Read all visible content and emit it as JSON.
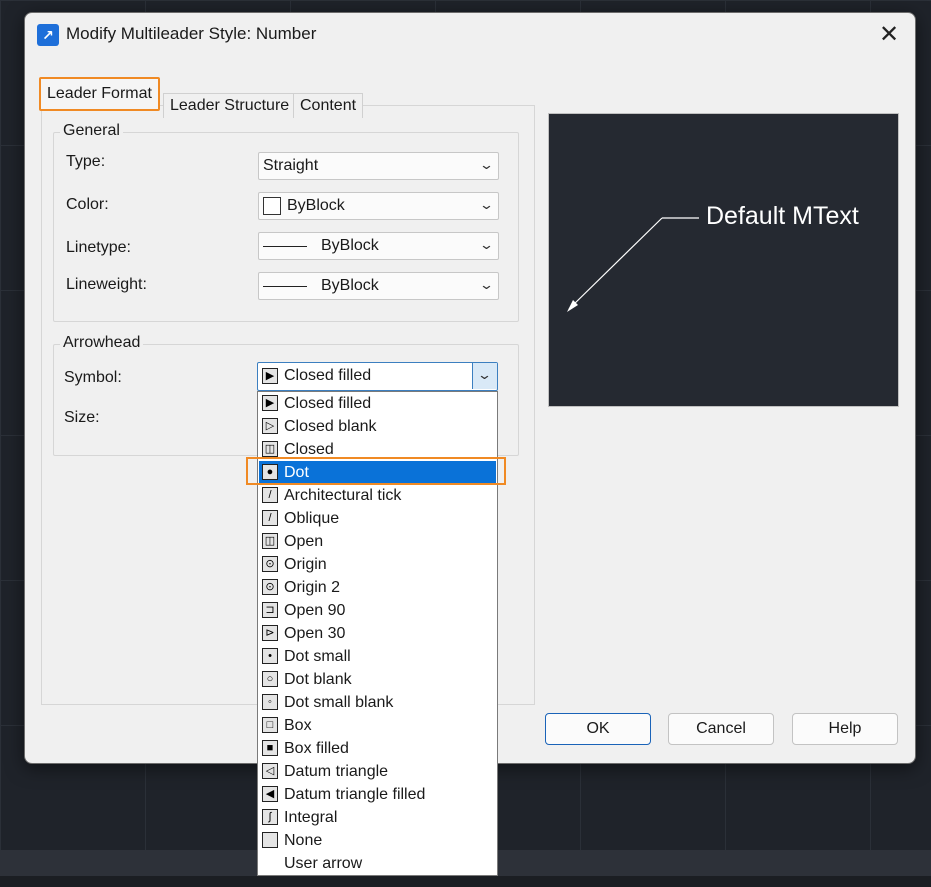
{
  "window": {
    "title": "Modify Multileader Style: Number",
    "close_glyph": "✕"
  },
  "tabs": [
    "Leader Format",
    "Leader Structure",
    "Content"
  ],
  "general": {
    "legend": "General",
    "type_label": "Type:",
    "type_value": "Straight",
    "color_label": "Color:",
    "color_value": "ByBlock",
    "linetype_label": "Linetype:",
    "linetype_value": "ByBlock",
    "lineweight_label": "Lineweight:",
    "lineweight_value": "ByBlock"
  },
  "arrowhead": {
    "legend": "Arrowhead",
    "symbol_label": "Symbol:",
    "symbol_value": "Closed filled",
    "size_label": "Size:",
    "options": [
      "Closed filled",
      "Closed blank",
      "Closed",
      "Dot",
      "Architectural tick",
      "Oblique",
      "Open",
      "Origin",
      "Origin 2",
      "Open 90",
      "Open 30",
      "Dot small",
      "Dot blank",
      "Dot small blank",
      "Box",
      "Box filled",
      "Datum triangle",
      "Datum triangle filled",
      "Integral",
      "None",
      "User arrow"
    ],
    "highlighted": "Dot"
  },
  "preview": {
    "text": "Default MText"
  },
  "buttons": {
    "ok": "OK",
    "cancel": "Cancel",
    "help": "Help"
  },
  "icons": {
    "app": "multileader-icon",
    "chevron": "chevron-down-icon",
    "option_glyphs": [
      "▶",
      "▷",
      "◫",
      "●",
      "/",
      "/",
      "◫",
      "⊙",
      "⊙",
      "⊐",
      "⊳",
      "•",
      "○",
      "◦",
      "□",
      "■",
      "◁",
      "◀",
      "∫",
      "",
      ""
    ]
  },
  "colors": {
    "highlight": "#0a72d8",
    "callout": "#f08a24",
    "preview_bg": "#252931"
  }
}
